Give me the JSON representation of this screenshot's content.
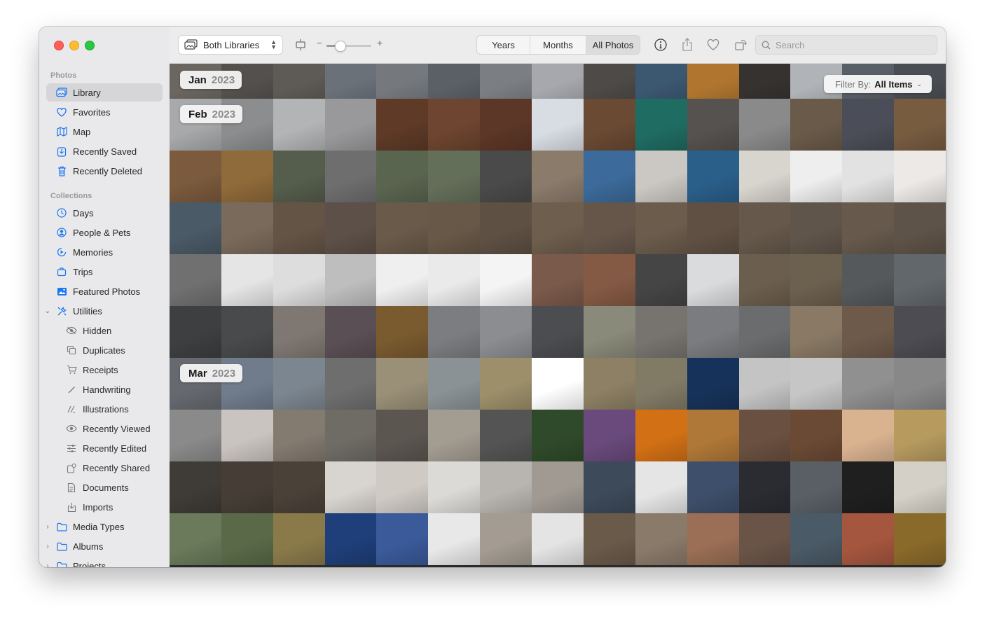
{
  "window": {
    "traffic_lights": [
      "close",
      "minimize",
      "zoom"
    ]
  },
  "sidebar": {
    "sections": [
      {
        "title": "Photos",
        "items": [
          {
            "label": "Library",
            "icon": "library-icon",
            "selected": true
          },
          {
            "label": "Favorites",
            "icon": "heart-icon"
          },
          {
            "label": "Map",
            "icon": "map-icon"
          },
          {
            "label": "Recently Saved",
            "icon": "recently-saved-icon"
          },
          {
            "label": "Recently Deleted",
            "icon": "trash-icon"
          }
        ]
      },
      {
        "title": "Collections",
        "items": [
          {
            "label": "Days",
            "icon": "clock-icon"
          },
          {
            "label": "People & Pets",
            "icon": "person-circle-icon"
          },
          {
            "label": "Memories",
            "icon": "memories-icon"
          },
          {
            "label": "Trips",
            "icon": "suitcase-icon"
          },
          {
            "label": "Featured Photos",
            "icon": "featured-photo-icon"
          },
          {
            "label": "Utilities",
            "icon": "wrench-icon",
            "expanded": true
          },
          {
            "label": "Hidden",
            "icon": "eye-slash-icon",
            "sub": true
          },
          {
            "label": "Duplicates",
            "icon": "duplicates-icon",
            "sub": true
          },
          {
            "label": "Receipts",
            "icon": "cart-icon",
            "sub": true
          },
          {
            "label": "Handwriting",
            "icon": "pencil-icon",
            "sub": true
          },
          {
            "label": "Illustrations",
            "icon": "illustrations-icon",
            "sub": true
          },
          {
            "label": "Recently Viewed",
            "icon": "eye-icon",
            "sub": true
          },
          {
            "label": "Recently Edited",
            "icon": "sliders-icon",
            "sub": true
          },
          {
            "label": "Recently Shared",
            "icon": "shared-icon",
            "sub": true
          },
          {
            "label": "Documents",
            "icon": "document-icon",
            "sub": true
          },
          {
            "label": "Imports",
            "icon": "import-icon",
            "sub": true
          },
          {
            "label": "Media Types",
            "icon": "folder-icon",
            "collapsed": true
          },
          {
            "label": "Albums",
            "icon": "folder-icon",
            "collapsed": true
          },
          {
            "label": "Projects",
            "icon": "folder-icon",
            "collapsed": true
          }
        ]
      }
    ]
  },
  "toolbar": {
    "library_select": "Both Libraries",
    "zoom_minus": "−",
    "zoom_plus": "+",
    "zoom_level": 0.3,
    "view_tabs": [
      {
        "label": "Years",
        "active": false
      },
      {
        "label": "Months",
        "active": false
      },
      {
        "label": "All Photos",
        "active": true
      }
    ],
    "search_placeholder": "Search"
  },
  "grid": {
    "filter_label": "Filter By:",
    "filter_value": "All Items",
    "months": [
      {
        "month": "Jan",
        "year": "2023"
      },
      {
        "month": "Feb",
        "year": "2023"
      },
      {
        "month": "Mar",
        "year": "2023"
      }
    ],
    "rows": [
      [
        "#6b6660",
        "#54504d",
        "#5e5a55",
        "#6a7179",
        "#75797e",
        "#5b6066",
        "#7b7e82",
        "#a6a8ad",
        "#4d4a47",
        "#3c5770",
        "#b0762f",
        "#353230",
        "#b0b3b7",
        "#595f66",
        "#4a4e54"
      ],
      [
        "#a8a9ab",
        "#8c8d8f",
        "#b3b4b6",
        "#99999b",
        "#5e3a27",
        "#6d4530",
        "#5c3626",
        "#d8dde3",
        "#6a4a33",
        "#1f6c63",
        "#55524f",
        "#8a8a8a",
        "#6a5a49",
        "#4b4e58",
        "#775c40"
      ],
      [
        "#7b5a3d",
        "#8f6a3a",
        "#555d4c",
        "#6e6e6e",
        "#5a6550",
        "#646f5a",
        "#4a4a4a",
        "#8a7b6b",
        "#3c6a9a",
        "#cbc8c4",
        "#2a5f8a",
        "#d8d4ce",
        "#eeeeee",
        "#e2e2e2",
        "#ece9e6"
      ],
      [
        "#4a5a66",
        "#7a6a5b",
        "#645446",
        "#5d5048",
        "#6a5a4a",
        "#685847",
        "#5e5043",
        "#6e5e4d",
        "#66564a",
        "#6b5c4c",
        "#5f5043",
        "#66584b",
        "#60554a",
        "#675a4d",
        "#5e5348"
      ],
      [
        "#707070",
        "#e5e5e5",
        "#dddddd",
        "#bebebe",
        "#efefef",
        "#eaeaea",
        "#f4f4f4",
        "#7a5a4a",
        "#855a44",
        "#454545",
        "#d9dbdc",
        "#6c5e4e",
        "#6c604f",
        "#55595c",
        "#62676b"
      ],
      [
        "#3d3f40",
        "#484a4b",
        "#7f7872",
        "#5a4f55",
        "#7a5a2f",
        "#7c7d80",
        "#8c8d90",
        "#4c4d50",
        "#8a8a7a",
        "#77746f",
        "#7a7c80",
        "#6b6c6e",
        "#8a7a65",
        "#6e5a4a",
        "#4c4c52"
      ],
      [
        "#666a70",
        "#707c8c",
        "#7c8690",
        "#6e6e6e",
        "#9a9078",
        "#8a9296",
        "#9c8f6a",
        "#ffffff",
        "#8d8064",
        "#817a65",
        "#17325a",
        "#c4c4c4",
        "#c6c6c6",
        "#909090",
        "#888888"
      ],
      [
        "#8a8a8a",
        "#c9c4bf",
        "#837a70",
        "#6e6c64",
        "#5b5650",
        "#a39c91",
        "#545454",
        "#2f4a2a",
        "#6a4a7c",
        "#d27015",
        "#b07838",
        "#6a5040",
        "#6a4a34",
        "#d9b290",
        "#b69a5e"
      ],
      [
        "#3f3b36",
        "#463e36",
        "#4a4138",
        "#d8d4cf",
        "#cfcac4",
        "#dcdad6",
        "#b8b5b1",
        "#a09a93",
        "#3d4a5a",
        "#e5e5e5",
        "#3d4f6a",
        "#2a2c32",
        "#5a5f66",
        "#1f1f1f",
        "#d4d0c7"
      ],
      [
        "#6a7a5a",
        "#5a6a48",
        "#8a7a4a",
        "#1f3f7a",
        "#3a5a9a",
        "#e8e8e8",
        "#a49c92",
        "#e4e4e4",
        "#6a5a4a",
        "#8a7a6a",
        "#9a6f55",
        "#6a5448",
        "#4a5a66",
        "#a5563e",
        "#8a6a2a"
      ]
    ]
  }
}
